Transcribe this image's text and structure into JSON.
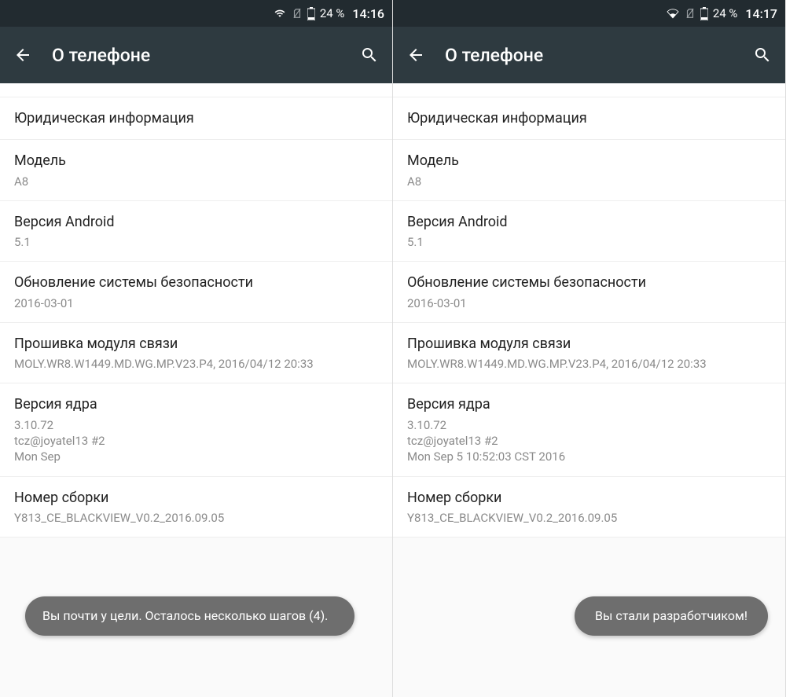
{
  "left": {
    "statusbar": {
      "battery": "24 %",
      "time": "14:16"
    },
    "appbar": {
      "title": "О телефоне"
    },
    "rows": {
      "legal": {
        "label": "Юридическая информация"
      },
      "model": {
        "label": "Модель",
        "value": "A8"
      },
      "android": {
        "label": "Версия Android",
        "value": "5.1"
      },
      "patch": {
        "label": "Обновление системы безопасности",
        "value": "2016-03-01"
      },
      "baseband": {
        "label": "Прошивка модуля связи",
        "value": "MOLY.WR8.W1449.MD.WG.MP.V23.P4, 2016/04/12 20:33"
      },
      "kernel": {
        "label": "Версия ядра",
        "value": "3.10.72\ntcz@joyatel13 #2\nMon Sep"
      },
      "build": {
        "label": "Номер сборки",
        "value": "Y813_CE_BLACKVIEW_V0.2_2016.09.05"
      }
    },
    "toast": "Вы почти у цели. Осталось несколько шагов (4)."
  },
  "right": {
    "statusbar": {
      "battery": "24 %",
      "time": "14:17"
    },
    "appbar": {
      "title": "О телефоне"
    },
    "rows": {
      "legal": {
        "label": "Юридическая информация"
      },
      "model": {
        "label": "Модель",
        "value": "A8"
      },
      "android": {
        "label": "Версия Android",
        "value": "5.1"
      },
      "patch": {
        "label": "Обновление системы безопасности",
        "value": "2016-03-01"
      },
      "baseband": {
        "label": "Прошивка модуля связи",
        "value": "MOLY.WR8.W1449.MD.WG.MP.V23.P4, 2016/04/12 20:33"
      },
      "kernel": {
        "label": "Версия ядра",
        "value": "3.10.72\ntcz@joyatel13 #2\nMon Sep 5 10:52:03 CST 2016"
      },
      "build": {
        "label": "Номер сборки",
        "value": "Y813_CE_BLACKVIEW_V0.2_2016.09.05"
      }
    },
    "toast": "Вы стали разработчиком!"
  }
}
